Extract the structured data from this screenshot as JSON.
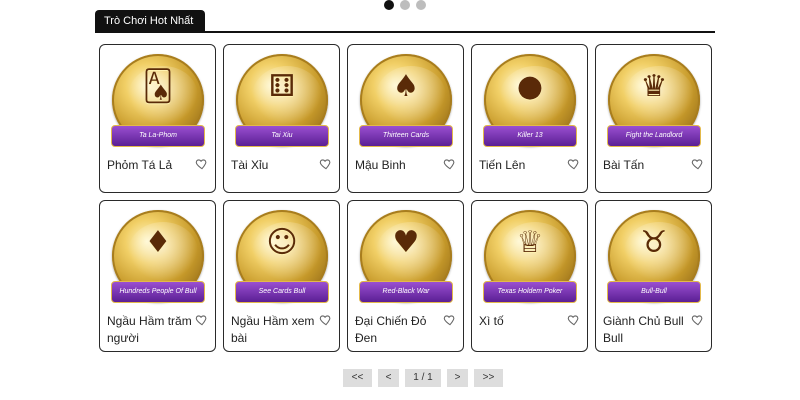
{
  "carousel": {
    "dots": 3,
    "active_index": 0
  },
  "section": {
    "title": "Trò Chơi Hot Nhất"
  },
  "games": [
    {
      "name": "Phỏm Tá Lả",
      "banner": "Ta La-Phom",
      "icon": "cards-icon"
    },
    {
      "name": "Tài Xỉu",
      "banner": "Tai Xiu",
      "icon": "dice-cup-icon"
    },
    {
      "name": "Mậu Binh",
      "banner": "Thirteen Cards",
      "icon": "revolver-cards-icon"
    },
    {
      "name": "Tiến Lên",
      "banner": "Killer 13",
      "icon": "bomb-icon"
    },
    {
      "name": "Bài Tấn",
      "banner": "Fight the Landlord",
      "icon": "landlord-icon"
    },
    {
      "name": "Ngầu Hầm trăm người",
      "banner": "Hundreds People Of Bull",
      "icon": "bull-cards-icon"
    },
    {
      "name": "Ngầu Hầm xem bài",
      "banner": "See Cards Bull",
      "icon": "cartoon-bull-icon"
    },
    {
      "name": "Đại Chiến Đỏ Đen",
      "banner": "Red-Black War",
      "icon": "vs-icon"
    },
    {
      "name": "Xì tố",
      "banner": "Texas Holdem Poker",
      "icon": "crown-icon"
    },
    {
      "name": "Giành Chủ Bull Bull",
      "banner": "Bull-Bull",
      "icon": "bull-head-icon"
    }
  ],
  "pagination": {
    "first": "<<",
    "prev": "<",
    "page": "1 / 1",
    "next": ">",
    "last": ">>"
  },
  "colors": {
    "ribbon": "#6a2aa8",
    "gold": "#c79a2a",
    "tab_bg": "#111111",
    "pager_bg": "#dddddd"
  }
}
